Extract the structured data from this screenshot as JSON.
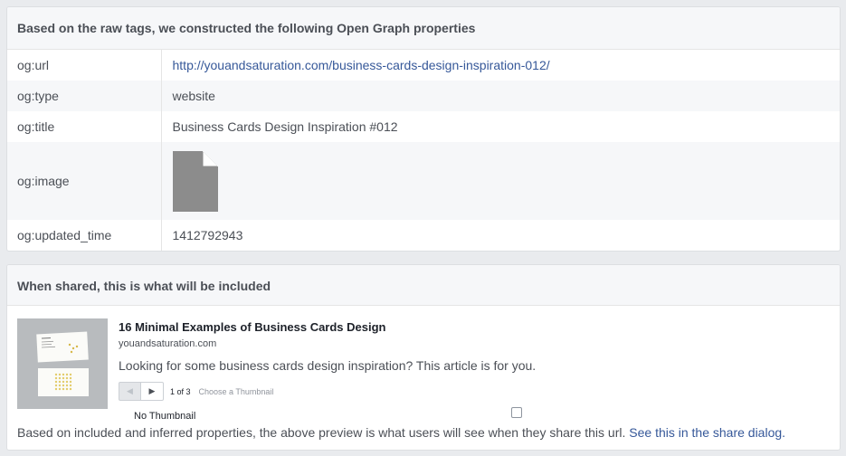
{
  "og_panel": {
    "header": "Based on the raw tags, we constructed the following Open Graph properties",
    "rows": [
      {
        "key": "og:url",
        "value": "http://youandsaturation.com/business-cards-design-inspiration-012/"
      },
      {
        "key": "og:type",
        "value": "website"
      },
      {
        "key": "og:title",
        "value": "Business Cards Design Inspiration #012"
      },
      {
        "key": "og:image",
        "icon": "document-placeholder-icon"
      },
      {
        "key": "og:updated_time",
        "value": "1412792943"
      }
    ]
  },
  "share_panel": {
    "header": "When shared, this is what will be included",
    "preview": {
      "title": "16 Minimal Examples of Business Cards Design",
      "domain": "youandsaturation.com",
      "description": "Looking for some business cards design inspiration? This article is for you.",
      "pager_count": "1 of 3",
      "pager_choose": "Choose a Thumbnail",
      "no_thumbnail_label": "No Thumbnail",
      "no_thumbnail_checked": false
    },
    "footnote_text": "Based on included and inferred properties, the above preview is what users will see when they share this url.",
    "footnote_link": "See this in the share dialog."
  },
  "colors": {
    "link": "#365899",
    "background": "#e9ebee",
    "header_bg": "#f6f7f9"
  }
}
